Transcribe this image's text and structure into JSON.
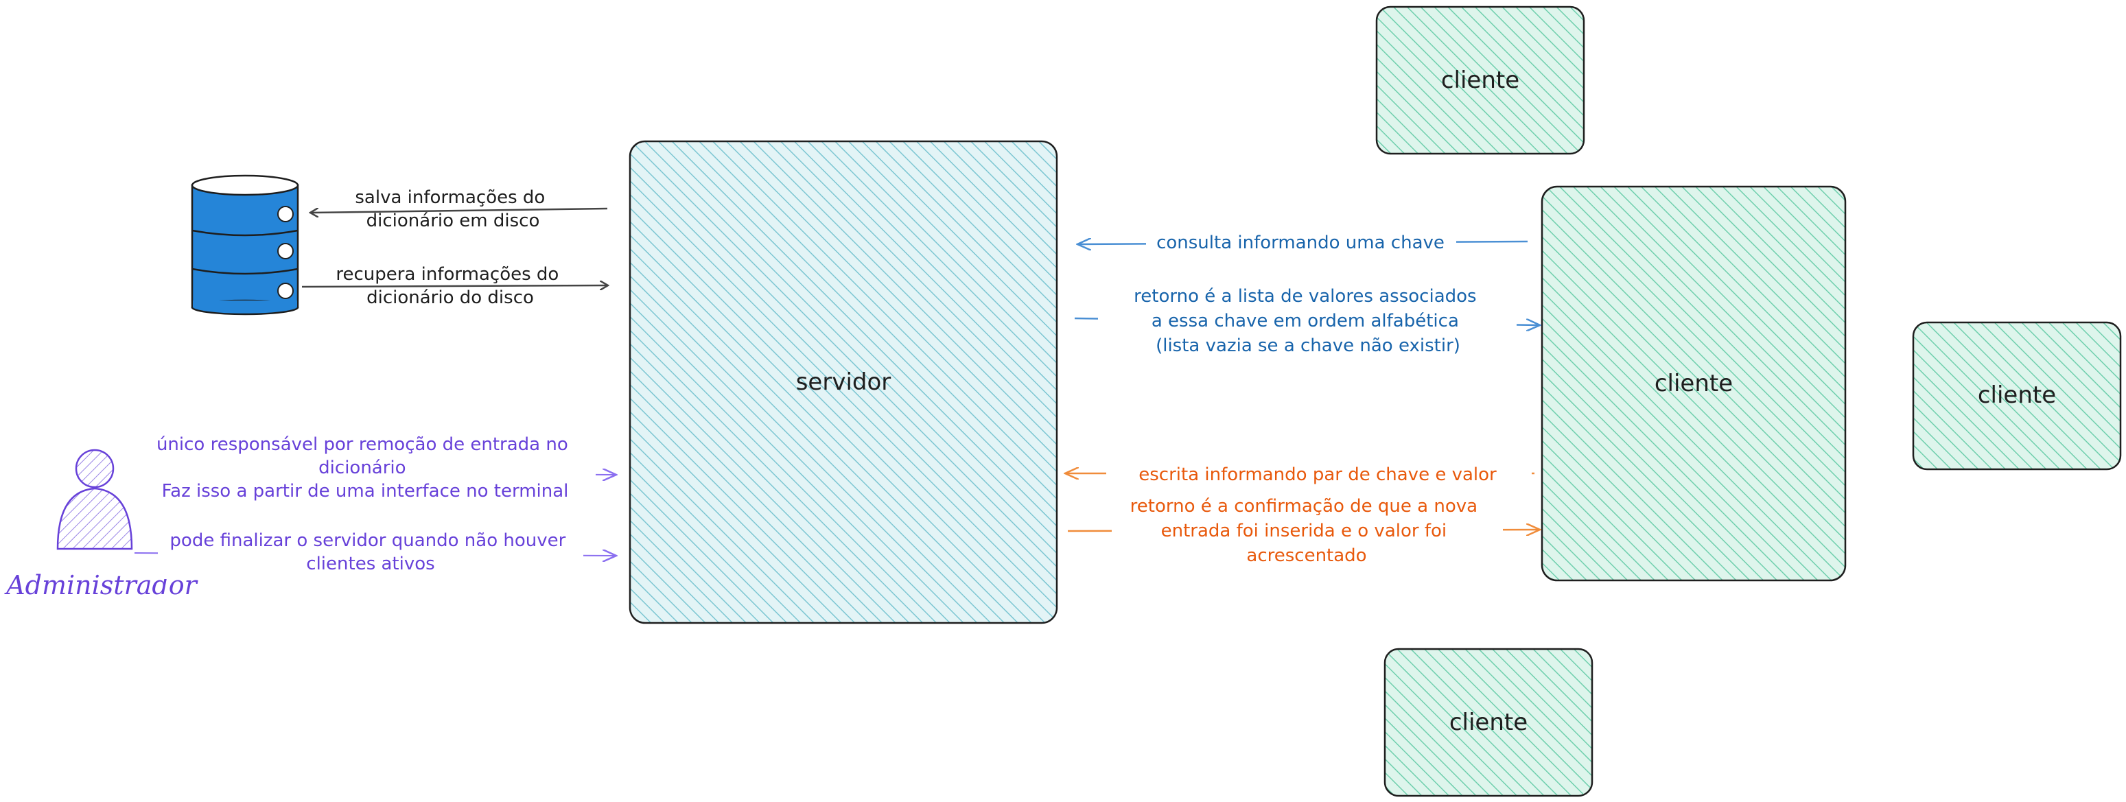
{
  "colors": {
    "server_fill": "#a5d8e0",
    "client_fill": "#96dcc5",
    "stroke": "#1e1e1e",
    "db_blue": "#2585d8",
    "blue_text": "#1864ab",
    "blue_arrow": "#4a8fd4",
    "orange": "#e8590c",
    "orange_arrow": "#f08c3a",
    "purple": "#6741d9",
    "purple_arrow": "#8b6ff0",
    "black_arrow": "#444444"
  },
  "icons": {
    "database": "database-icon",
    "admin": "user-icon"
  },
  "server": {
    "label": "servidor"
  },
  "clients": [
    {
      "label": "cliente"
    },
    {
      "label": "cliente"
    },
    {
      "label": "cliente"
    },
    {
      "label": "cliente"
    }
  ],
  "database": {
    "save_text": [
      "salva informações do",
      "dicionário em disco"
    ],
    "load_text": [
      "recupera informações do",
      "dicionário do disco"
    ]
  },
  "admin": {
    "name": "Administrador",
    "remove_text": [
      "único responsável por remoção de entrada no",
      "dicionário",
      "Faz isso a partir de uma interface no terminal"
    ],
    "shutdown_text": [
      "pode finalizar o servidor quando não houver",
      "clientes ativos"
    ]
  },
  "messages": {
    "query": [
      "consulta informando uma chave"
    ],
    "query_return": [
      "retorno é a lista de valores associados",
      "a essa chave em ordem alfabética",
      "(lista vazia se a chave não existir)"
    ],
    "write": [
      "escrita informando par de chave e valor"
    ],
    "write_return": [
      "retorno é a confirmação de que a nova",
      "entrada foi inserida e o valor foi",
      "acrescentado"
    ]
  }
}
